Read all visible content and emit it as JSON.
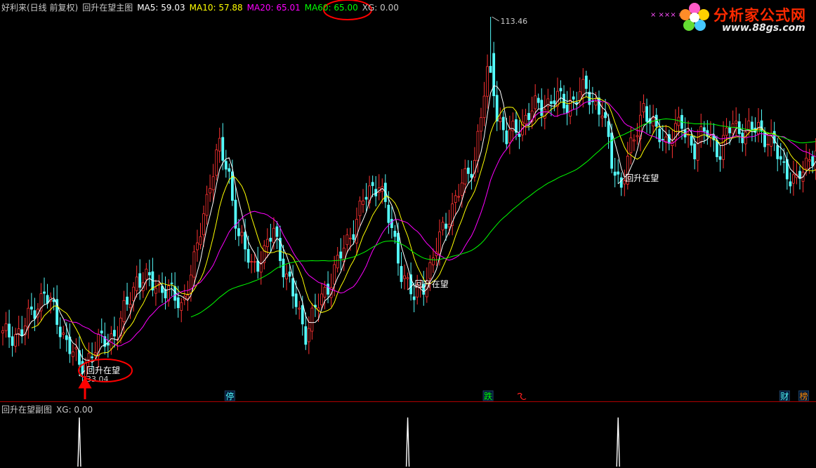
{
  "main_legend": {
    "stock": "好利来(日线 前复权)",
    "indicator": "回升在望主图",
    "ma5": "MA5: 59.03",
    "ma10": "MA10: 57.88",
    "ma20": "MA20: 65.01",
    "ma60": "MA60: 65.00",
    "xg": "XG: 0.00"
  },
  "sub_legend": {
    "indicator": "回升在望副图",
    "xg": "XG: 0.00"
  },
  "colors": {
    "ma5": "#ffffff",
    "ma10": "#ffff00",
    "ma20": "#ff00ff",
    "ma60": "#00ff00",
    "up": "#ff3232",
    "down": "#54fcfc",
    "highlight": "#ff0000"
  },
  "watermark": {
    "brand": "分析家公式网",
    "url": "www.88gs.com",
    "marks": "× ×××  ›"
  },
  "chart_data": {
    "type": "candlestick",
    "series": [
      {
        "name": "MA5"
      },
      {
        "name": "MA10"
      },
      {
        "name": "MA20"
      },
      {
        "name": "MA60"
      }
    ],
    "price_labels": {
      "high": "113.46",
      "low": "33.04"
    },
    "signal_label": "回升在望",
    "signal_bar_indices": [
      24,
      127,
      193
    ],
    "markers": [
      {
        "label": "停",
        "color": "#54fcfc",
        "bar_index": 71
      },
      {
        "label": "跌",
        "color": "#00ff00",
        "bar_index": 152
      },
      {
        "label": "财",
        "color": "#54fcfc",
        "bar_index": 245
      },
      {
        "label": "榜",
        "color": "#ff8800",
        "bar_index": 251
      }
    ],
    "sub_chart": {
      "signal_value": 1,
      "xg_value": 0
    }
  }
}
